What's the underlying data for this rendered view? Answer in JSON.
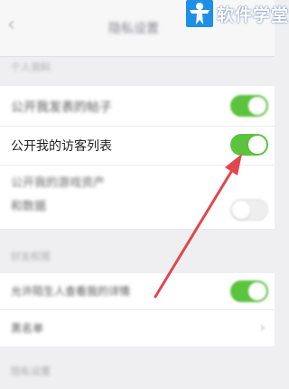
{
  "header": {
    "back_glyph": "‹",
    "title": "隐私设置"
  },
  "logo": {
    "text": "软件学堂",
    "icon": "stick-figure-logo-icon"
  },
  "sections": {
    "section1_label": "个人资料",
    "section2_label": "好友权限",
    "section3_label": "隐私设置"
  },
  "rows": {
    "row1_label": "公开我发表的帖子",
    "row2_label": "公开我的访客列表",
    "row3_label_line1": "公开我的游戏资产",
    "row3_label_line2": "和数据",
    "row4_label": "允许陌生人查看我的详情",
    "row5_label": "黑名单",
    "chevron_glyph": "›"
  },
  "toggles": {
    "row1": "on",
    "row2": "on",
    "row3": "off",
    "row4": "on"
  },
  "colors": {
    "toggle_on": "#5cc33f",
    "arrow": "#e0474c",
    "logo_blue": "#1d8fe6"
  }
}
